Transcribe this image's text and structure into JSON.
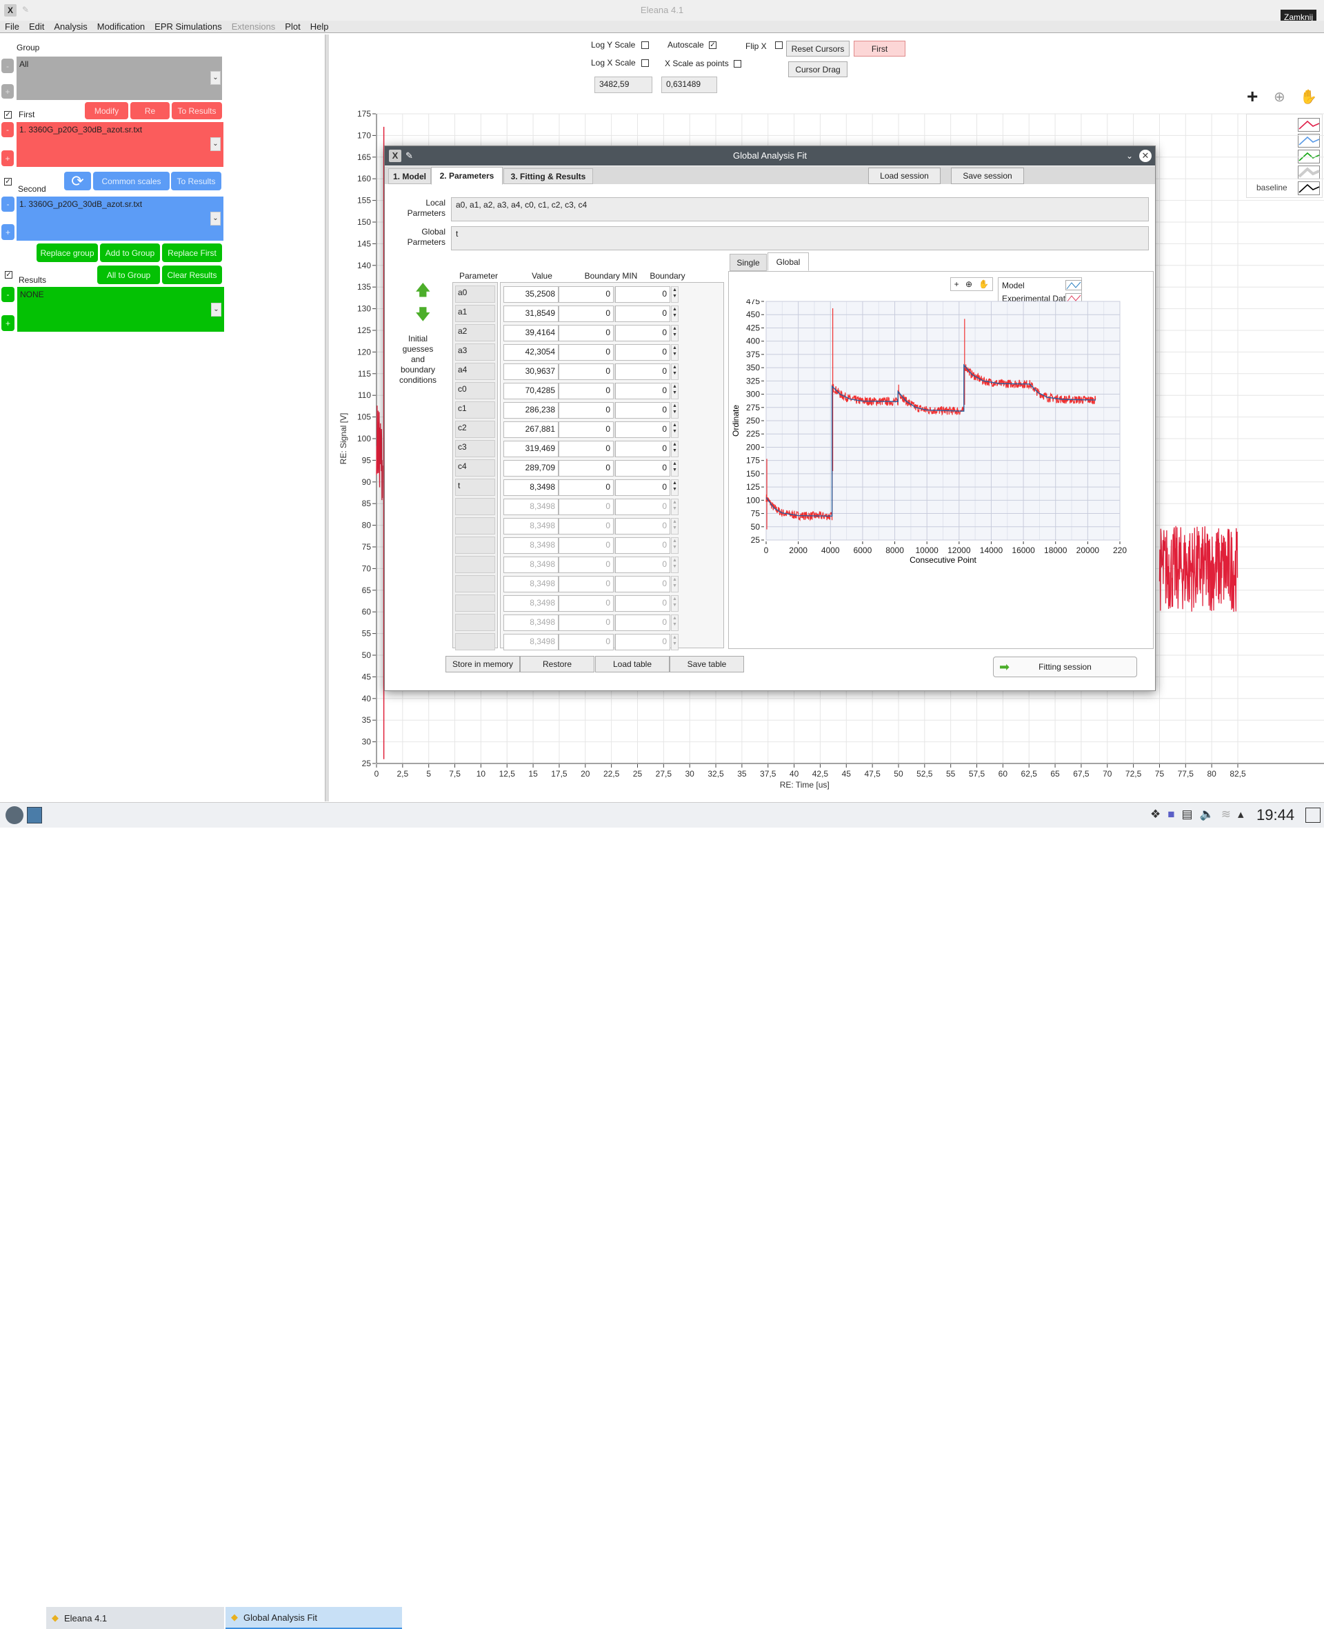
{
  "window": {
    "title": "Eleana 4.1",
    "tooltip": "Zamknij"
  },
  "menu": [
    "File",
    "Edit",
    "Analysis",
    "Modification",
    "EPR Simulations",
    "Extensions",
    "Plot",
    "Help"
  ],
  "left": {
    "group": {
      "label": "Group",
      "value": "All"
    },
    "first": {
      "label": "First",
      "checked": true,
      "value": "1.  3360G_p20G_30dB_azot.sr.txt",
      "buttons": [
        "Modify",
        "Re",
        "To Results"
      ]
    },
    "second": {
      "label": "Second",
      "checked": true,
      "value": "1.  3360G_p20G_30dB_azot.sr.txt",
      "buttons": [
        "Common scales",
        "To Results"
      ]
    },
    "group_buttons": [
      "Replace group",
      "Add to Group",
      "Replace First",
      "All to Group",
      "Clear Results"
    ],
    "results": {
      "label": "Results",
      "checked": true,
      "value": "NONE"
    },
    "minus": "-",
    "plus": "+",
    "colors": {
      "first": "#fb5c5c",
      "second": "#5c9cf6",
      "results": "#04c104",
      "group": "#ababab"
    }
  },
  "toolbar": {
    "log_y": {
      "label": "Log Y Scale",
      "checked": false
    },
    "log_x": {
      "label": "Log X Scale",
      "checked": false
    },
    "autoscale": {
      "label": "Autoscale",
      "checked": true
    },
    "x_points": {
      "label": "X Scale as points",
      "checked": false
    },
    "flip_x": {
      "label": "Flip X",
      "checked": false
    },
    "reset_cursors": "Reset Cursors",
    "first": "First",
    "cursor_drag": "Cursor Drag",
    "cursor_x": "3482,59",
    "cursor_y": "0,631489",
    "tools": [
      "crosshair-icon",
      "zoom-icon",
      "hand-icon"
    ]
  },
  "main_legend": [
    {
      "label": "",
      "color": "#e0204a"
    },
    {
      "label": "",
      "color": "#5a9ae6"
    },
    {
      "label": "",
      "color": "#12a612"
    },
    {
      "label": "",
      "color": "#cccccc"
    },
    {
      "label": "baseline",
      "color": "#000000"
    }
  ],
  "dialog": {
    "title": "Global Analysis Fit",
    "tabs": [
      "1. Model",
      "2. Parameters",
      "3. Fitting & Results"
    ],
    "active_tab": "2. Parameters",
    "load_session": "Load session",
    "save_session": "Save session",
    "local_label": "Local\nParmeters",
    "local_value": "a0, a1, a2, a3, a4, c0, c1, c2, c3, c4",
    "global_label": "Global\nParmeters",
    "global_value": "t",
    "side_label": "Initial\nguesses\nand\nboundary\nconditions",
    "columns": [
      "Parameter",
      "Value",
      "Boundary MIN",
      "Boundary MAX"
    ],
    "rows": [
      {
        "p": "a0",
        "v": "35,2508",
        "min": "0",
        "max": "0"
      },
      {
        "p": "a1",
        "v": "31,8549",
        "min": "0",
        "max": "0"
      },
      {
        "p": "a2",
        "v": "39,4164",
        "min": "0",
        "max": "0"
      },
      {
        "p": "a3",
        "v": "42,3054",
        "min": "0",
        "max": "0"
      },
      {
        "p": "a4",
        "v": "30,9637",
        "min": "0",
        "max": "0"
      },
      {
        "p": "c0",
        "v": "70,4285",
        "min": "0",
        "max": "0"
      },
      {
        "p": "c1",
        "v": "286,238",
        "min": "0",
        "max": "0"
      },
      {
        "p": "c2",
        "v": "267,881",
        "min": "0",
        "max": "0"
      },
      {
        "p": "c3",
        "v": "319,469",
        "min": "0",
        "max": "0"
      },
      {
        "p": "c4",
        "v": "289,709",
        "min": "0",
        "max": "0"
      },
      {
        "p": "t",
        "v": "8,3498",
        "min": "0",
        "max": "0"
      }
    ],
    "disabled_rows": [
      {
        "v": "8,3498",
        "min": "0",
        "max": "0"
      },
      {
        "v": "8,3498",
        "min": "0",
        "max": "0"
      },
      {
        "v": "8,3498",
        "min": "0",
        "max": "0"
      },
      {
        "v": "8,3498",
        "min": "0",
        "max": "0"
      },
      {
        "v": "8,3498",
        "min": "0",
        "max": "0"
      },
      {
        "v": "8,3498",
        "min": "0",
        "max": "0"
      },
      {
        "v": "8,3498",
        "min": "0",
        "max": "0"
      },
      {
        "v": "8,3498",
        "min": "0",
        "max": "0"
      }
    ],
    "table_buttons": [
      "Store in memory",
      "Restore",
      "Load table",
      "Save table"
    ],
    "plot_tabs": [
      "Single",
      "Global"
    ],
    "active_plot_tab": "Global",
    "fitting_session": "Fitting session"
  },
  "chart_data": [
    {
      "type": "line",
      "xlabel": "Consecutive Point",
      "ylabel": "Ordinate",
      "xlim": [
        0,
        22000
      ],
      "ylim": [
        25,
        475
      ],
      "xticks": [
        "0",
        "2000",
        "4000",
        "6000",
        "8000",
        "10000",
        "12000",
        "14000",
        "16000",
        "18000",
        "20000",
        "220"
      ],
      "yticks": [
        "25",
        "50",
        "75",
        "100",
        "125",
        "150",
        "175",
        "200",
        "225",
        "250",
        "275",
        "300",
        "325",
        "350",
        "375",
        "400",
        "425",
        "450",
        "475"
      ],
      "grid": true,
      "legend": "top-right",
      "series": [
        {
          "name": "Model",
          "color": "#1f5fa0",
          "x": [
            0,
            500,
            1000,
            2000,
            4100,
            4101,
            4600,
            5200,
            6000,
            8200,
            8201,
            8700,
            9300,
            10000,
            12300,
            12301,
            12800,
            13500,
            14500,
            16400,
            16900,
            17500,
            18500,
            20500
          ],
          "y": [
            105,
            85,
            76,
            71,
            70,
            315,
            300,
            291,
            287,
            286,
            305,
            287,
            275,
            270,
            268,
            355,
            337,
            325,
            320,
            319,
            303,
            294,
            290,
            289
          ]
        },
        {
          "name": "Experimental Data",
          "color": "#f03030",
          "spikes": [
            {
              "x": 0,
              "ymin": 45,
              "ymax": 178
            },
            {
              "x": 4100,
              "ymin": 155,
              "ymax": 462
            },
            {
              "x": 8200,
              "ymin": 300,
              "ymax": 318
            },
            {
              "x": 12300,
              "ymin": 280,
              "ymax": 442
            }
          ]
        }
      ]
    },
    {
      "type": "line",
      "xlabel": "RE: Time [us]",
      "ylabel": "RE: Signal [V]",
      "xlim": [
        0,
        82.5
      ],
      "ylim": [
        25,
        175
      ],
      "xticks": [
        "0",
        "2,5",
        "5",
        "7,5",
        "10",
        "12,5",
        "15",
        "17,5",
        "20",
        "22,5",
        "25",
        "27,5",
        "30",
        "32,5",
        "35",
        "37,5",
        "40",
        "42,5",
        "45",
        "47,5",
        "50",
        "52,5",
        "55",
        "57,5",
        "60",
        "62,5",
        "65",
        "67,5",
        "70",
        "72,5",
        "75",
        "77,5",
        "80",
        "82,5"
      ],
      "yticks": [
        "25",
        "30",
        "35",
        "40",
        "45",
        "50",
        "55",
        "60",
        "65",
        "70",
        "75",
        "80",
        "85",
        "90",
        "95",
        "100",
        "105",
        "110",
        "115",
        "120",
        "125",
        "130",
        "135",
        "140",
        "145",
        "150",
        "155",
        "160",
        "165",
        "170",
        "175"
      ],
      "grid": true,
      "series": [
        {
          "color": "#e0203a",
          "x": [
            0,
            0.3,
            0.6,
            0.7,
            0.75,
            0.8,
            75,
            82.5
          ],
          "y": [
            105,
            98,
            92,
            172,
            26,
            60,
            70,
            70
          ]
        }
      ]
    }
  ],
  "taskbar": {
    "tasks": [
      "Eleana 4.1",
      "Global Analysis Fit"
    ],
    "clock": "19:44"
  }
}
